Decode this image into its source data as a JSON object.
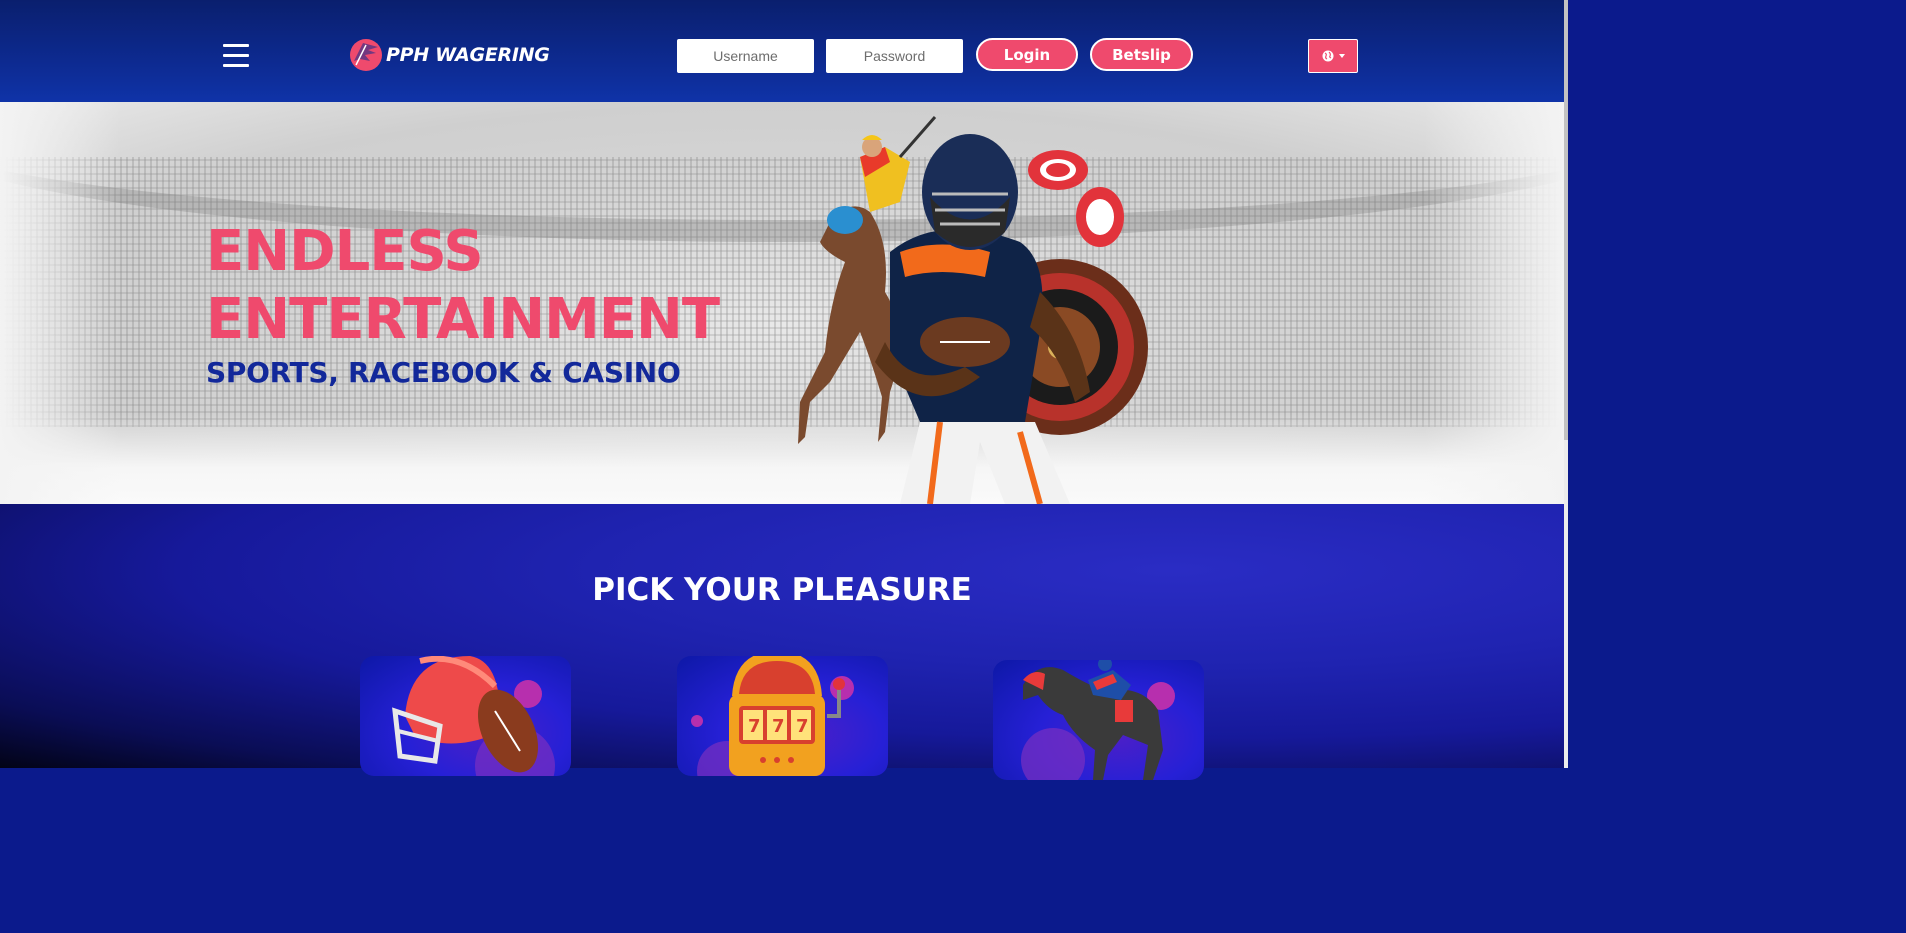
{
  "header": {
    "brand": "PPH WAGERING",
    "username_placeholder": "Username",
    "password_placeholder": "Password",
    "login_label": "Login",
    "betslip_label": "Betslip",
    "language_icon": "globe-icon"
  },
  "hero": {
    "title_line1": "ENDLESS",
    "title_line2": "ENTERTAINMENT",
    "subtitle": "SPORTS, RACEBOOK & CASINO"
  },
  "pick": {
    "title": "PICK YOUR PLEASURE",
    "cards": [
      {
        "icon": "football-helmet-icon"
      },
      {
        "icon": "slot-machine-icon"
      },
      {
        "icon": "racehorse-icon"
      }
    ]
  },
  "colors": {
    "accent": "#ef4a6d",
    "navy": "#12289a",
    "header_bg": "#0d2a90"
  }
}
